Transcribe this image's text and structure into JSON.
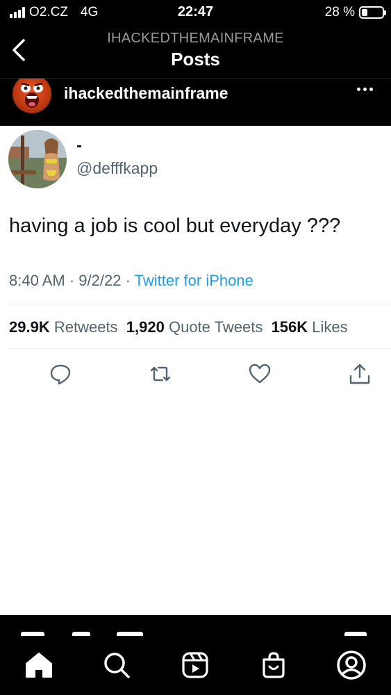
{
  "status_bar": {
    "carrier": "O2.CZ",
    "network": "4G",
    "time": "22:47",
    "battery_text": "28 %",
    "battery_level": 0.28
  },
  "header": {
    "supertitle": "IHACKEDTHEMAINFRAME",
    "title": "Posts"
  },
  "post": {
    "username": "ihackedthemainframe",
    "avatar_icon": "screaming-face-icon"
  },
  "tweet": {
    "display_name": "-",
    "handle": "@defffkapp",
    "text": "having a job is cool but everyday ???",
    "time": "8:40 AM",
    "date": "9/2/22",
    "separator": "·",
    "source": "Twitter for iPhone",
    "retweets_count": "29.9K",
    "retweets_label": "Retweets",
    "quotes_count": "1,920",
    "quotes_label": "Quote Tweets",
    "likes_count": "156K",
    "likes_label": "Likes",
    "actions": [
      "reply-icon",
      "retweet-icon",
      "like-icon",
      "share-icon"
    ]
  },
  "bottom_nav": [
    "home-icon",
    "search-icon",
    "reels-icon",
    "shop-icon",
    "profile-icon"
  ],
  "colors": {
    "link_blue": "#1d9bf0",
    "muted_gray": "#536471",
    "text_dark": "#0f1419"
  }
}
